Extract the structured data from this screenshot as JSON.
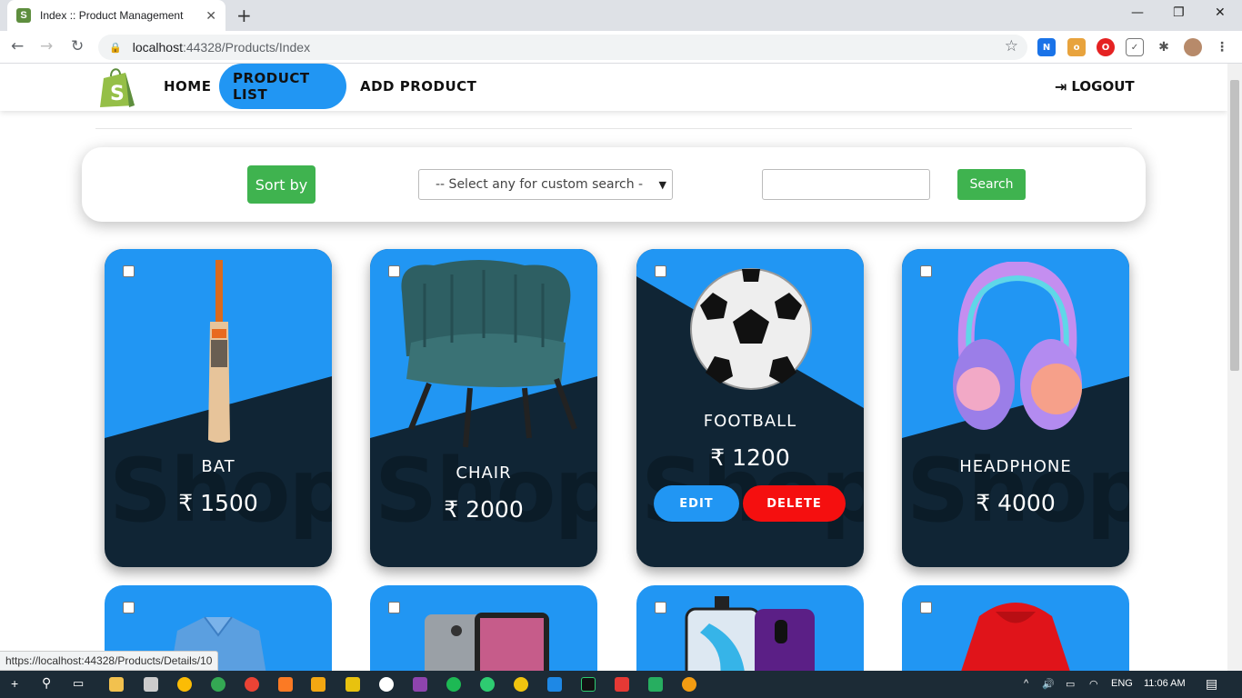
{
  "browser": {
    "tab_title": "Index :: Product Management",
    "tab_close": "✕",
    "new_tab": "+",
    "url_host": "localhost",
    "url_path": ":44328/Products/Index",
    "status_url": "https://localhost:44328/Products/Details/10"
  },
  "nav": {
    "home": "HOME",
    "product_list": "PRODUCT LIST",
    "add_product": "ADD PRODUCT",
    "logout": "LOGOUT"
  },
  "search": {
    "sort_label": "Sort by",
    "select_value": "-- Select any for custom search -",
    "search_label": "Search",
    "input_value": ""
  },
  "products": [
    {
      "name": "BAT",
      "price": "₹ 1500"
    },
    {
      "name": "CHAIR",
      "price": "₹ 2000"
    },
    {
      "name": "FOOTBALL",
      "price": "₹ 1200",
      "edit": "EDIT",
      "delete": "DELETE"
    },
    {
      "name": "HEADPHONE",
      "price": "₹ 4000"
    }
  ],
  "watermark": "Shop",
  "taskbar": {
    "lang": "ENG",
    "time": "11:06 AM"
  },
  "colors": {
    "accent": "#2196f3",
    "card_dark": "#102535",
    "button_green": "#3fb34f",
    "delete_red": "#f50f0f"
  }
}
